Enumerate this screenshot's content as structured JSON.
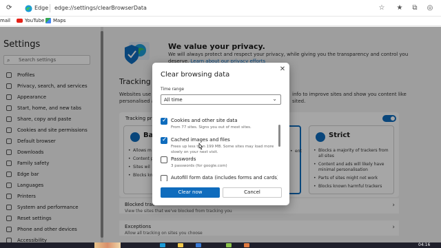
{
  "browser": {
    "brand": "Edge",
    "url_scheme": "edge://",
    "url_path": "settings/clearBrowserData",
    "favorites": [
      {
        "label": "mail"
      },
      {
        "label": "YouTube"
      },
      {
        "label": "Maps"
      }
    ]
  },
  "sidebar": {
    "title": "Settings",
    "search_placeholder": "Search settings",
    "items": [
      {
        "label": "Profiles",
        "icon": "profile-icon"
      },
      {
        "label": "Privacy, search, and services",
        "icon": "lock-icon"
      },
      {
        "label": "Appearance",
        "icon": "appearance-icon"
      },
      {
        "label": "Start, home, and new tabs",
        "icon": "home-icon"
      },
      {
        "label": "Share, copy and paste",
        "icon": "share-icon"
      },
      {
        "label": "Cookies and site permissions",
        "icon": "cookie-icon"
      },
      {
        "label": "Default browser",
        "icon": "browser-icon"
      },
      {
        "label": "Downloads",
        "icon": "download-icon"
      },
      {
        "label": "Family safety",
        "icon": "family-icon"
      },
      {
        "label": "Edge bar",
        "icon": "edgebar-icon"
      },
      {
        "label": "Languages",
        "icon": "language-icon"
      },
      {
        "label": "Printers",
        "icon": "printer-icon"
      },
      {
        "label": "System and performance",
        "icon": "system-icon"
      },
      {
        "label": "Reset settings",
        "icon": "reset-icon"
      },
      {
        "label": "Phone and other devices",
        "icon": "phone-icon"
      },
      {
        "label": "Accessibility",
        "icon": "accessibility-icon"
      }
    ]
  },
  "main": {
    "privacy_title": "We value your privacy.",
    "privacy_desc": "We will always protect and respect your privacy, while giving you the transparency and control you deserve.",
    "privacy_link": "Learn about our privacy efforts",
    "tracking_title": "Tracking p",
    "tracking_desc_left": "Websites use t",
    "tracking_desc_left2": "personalised ad",
    "tracking_desc_right": "info to improve sites and show you content like",
    "tracking_desc_right2": "sited.",
    "tracking_label": "Tracking pr",
    "options": [
      {
        "name": "Ba",
        "bullets": [
          "Allows m",
          "Content personal",
          "Sites wil",
          "Blocks kn"
        ]
      },
      {
        "name": "",
        "bullets": [
          "",
          "ent"
        ]
      },
      {
        "name": "Strict",
        "bullets": [
          "Blocks a majority of trackers from all sites",
          "Content and ads will likely have minimal personalisation",
          "Parts of sites might not work",
          "Blocks known harmful trackers"
        ]
      }
    ],
    "blocked_label": "Blocked trac",
    "blocked_sub": "View the sites that we've blocked from tracking you",
    "exceptions_label": "Exceptions",
    "exceptions_sub": "Allow all tracking on sites you choose"
  },
  "dialog": {
    "title": "Clear browsing data",
    "time_range_label": "Time range",
    "time_range_value": "All time",
    "items": [
      {
        "label": "Cookies and other site data",
        "desc": "From 77 sites. Signs you out of most sites.",
        "checked": true
      },
      {
        "label": "Cached images and files",
        "desc": "Frees up less than 199 MB. Some sites may load more slowly on your next visit.",
        "checked": true
      },
      {
        "label": "Passwords",
        "desc": "3 passwords (for google.com)",
        "checked": false
      },
      {
        "label": "Autofill form data (includes forms and cards)",
        "desc": "",
        "checked": false
      }
    ],
    "clear_label": "Clear now",
    "cancel_label": "Cancel"
  },
  "taskbar": {
    "time": "04:16"
  },
  "colors": {
    "accent": "#0f6cbd",
    "overlay": "rgba(0,0,0,0.35)"
  }
}
